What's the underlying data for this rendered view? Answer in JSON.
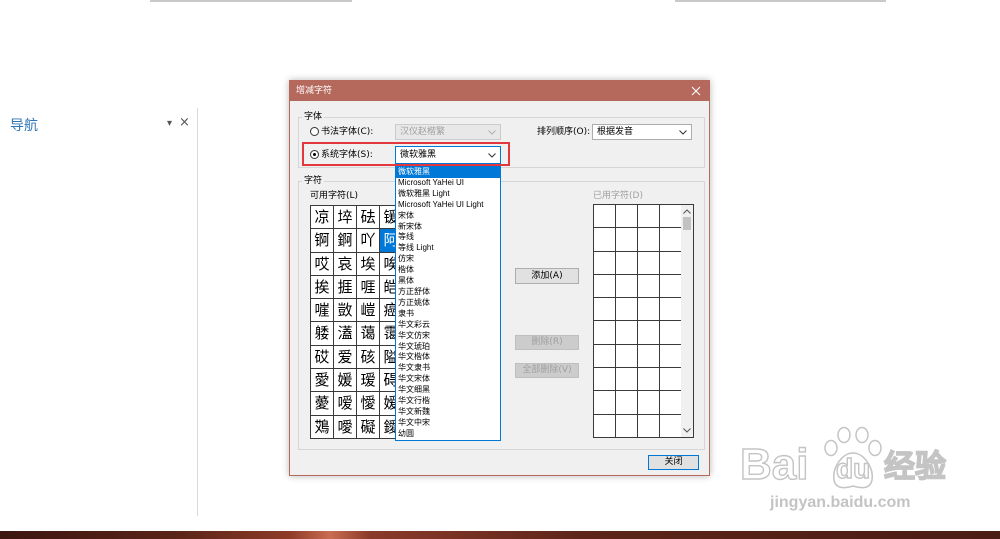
{
  "colors": {
    "title_bar": "#b5685c",
    "accent": "#0078d7",
    "highlight_box": "#e2373c",
    "nav_title": "#2e75b6"
  },
  "nav_pane": {
    "title": "导航",
    "menu_icon": "chevron-down-icon",
    "menu_glyph": "▾",
    "close_icon": "close-icon",
    "close_glyph": "×"
  },
  "dialog": {
    "title": "增减字符",
    "close_icon": "close-icon",
    "font_group": {
      "label": "字体",
      "calligraphy_option": {
        "label": "书法字体(C):",
        "checked": false,
        "enabled": false,
        "font_value": "汉仪赵楷繁"
      },
      "system_option": {
        "label": "系统字体(S):",
        "checked": true,
        "enabled": true,
        "font_value": "微软雅黑"
      },
      "sort_order": {
        "label": "排列顺序(O):",
        "value": "根据发音"
      }
    },
    "font_dropdown": {
      "open": true,
      "selected": "微软雅黑",
      "options": [
        "微软雅黑",
        "Microsoft YaHei UI",
        "微软雅黑 Light",
        "Microsoft YaHei UI Light",
        "宋体",
        "新宋体",
        "等线",
        "等线 Light",
        "仿宋",
        "楷体",
        "黑体",
        "方正舒体",
        "方正姚体",
        "隶书",
        "华文彩云",
        "华文仿宋",
        "华文琥珀",
        "华文楷体",
        "华文隶书",
        "华文宋体",
        "华文细黑",
        "华文行楷",
        "华文新魏",
        "华文中宋",
        "幼圆"
      ]
    },
    "char_group": {
      "label": "字符",
      "available": {
        "label": "可用字符(L)",
        "selected": "阿",
        "rows": [
          [
            "凉",
            "埣",
            "砝",
            "锾"
          ],
          [
            "锕",
            "錒",
            "吖",
            "阿"
          ],
          [
            "哎",
            "哀",
            "埃",
            "唉"
          ],
          [
            "挨",
            "捱",
            "啀",
            "皑"
          ],
          [
            "嘊",
            "敳",
            "嵦",
            "癌"
          ],
          [
            "躷",
            "濭",
            "蔼",
            "霭"
          ],
          [
            "砹",
            "爱",
            "硋",
            "隘"
          ],
          [
            "愛",
            "媛",
            "瑷",
            "碍"
          ],
          [
            "薆",
            "嗳",
            "懓",
            "嫒"
          ],
          [
            "鴱",
            "噯",
            "礙",
            "鑀"
          ]
        ]
      },
      "used": {
        "label": "已用字符(D)",
        "chars": []
      },
      "add_button": "添加(A)",
      "remove_button": "删除(R)",
      "remove_all_button": "全部删除(V)"
    },
    "close_button": "关闭"
  },
  "watermark": {
    "logo_icon": "paw-icon",
    "brand_left": "Bai",
    "brand_right": "du",
    "product": "经验",
    "url": "jingyan.baidu.com"
  }
}
